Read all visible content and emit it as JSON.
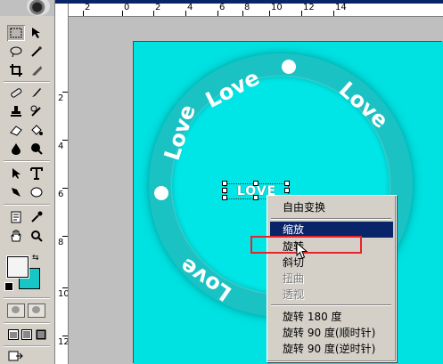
{
  "ruler": {
    "top_labels": [
      "2",
      "0",
      "2",
      "4",
      "6",
      "8",
      "10",
      "12",
      "14"
    ],
    "left_labels": [
      "2",
      "4",
      "6",
      "8",
      "10",
      "12"
    ]
  },
  "canvas": {
    "background": "#00e1e1",
    "ring_color": "#1bc2c3",
    "arc_text_top": "Love",
    "arc_text_right": "Love",
    "arc_text_left": "Love",
    "arc_text_bottom": "Love",
    "selected_text": "LOVE"
  },
  "colors": {
    "foreground": "#f4f4f4",
    "background": "#16c7c5",
    "menu_highlight": "#0a246a",
    "annotation_box": "#e8232a"
  },
  "context_menu": {
    "items": [
      {
        "label": "自由变换",
        "state": "normal"
      },
      {
        "label": "缩放",
        "state": "highlighted"
      },
      {
        "label": "旋转",
        "state": "normal"
      },
      {
        "label": "斜切",
        "state": "normal"
      },
      {
        "label": "扭曲",
        "state": "disabled"
      },
      {
        "label": "透视",
        "state": "disabled"
      },
      {
        "label": "旋转 180 度",
        "state": "normal"
      },
      {
        "label": "旋转 90 度(顺时针)",
        "state": "normal"
      },
      {
        "label": "旋转 90 度(逆时针)",
        "state": "normal"
      }
    ]
  },
  "tools": {
    "icons": [
      "marquee-icon",
      "move-icon",
      "lasso-icon",
      "magic-wand-icon",
      "crop-icon",
      "slice-icon",
      "healing-brush-icon",
      "brush-icon",
      "clone-stamp-icon",
      "history-brush-icon",
      "eraser-icon",
      "paint-bucket-icon",
      "blur-icon",
      "dodge-icon",
      "path-selection-icon",
      "type-icon",
      "pen-icon",
      "shape-icon",
      "notes-icon",
      "eyedropper-icon",
      "hand-icon",
      "zoom-icon"
    ]
  }
}
